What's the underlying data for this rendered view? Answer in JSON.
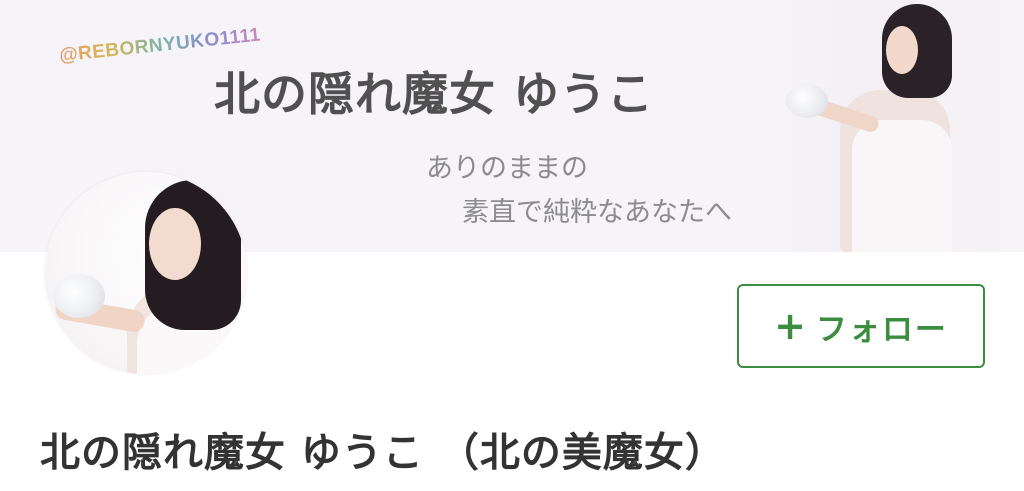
{
  "cover": {
    "handle": "@REBORNYUKO1111",
    "title": "北の隠れ魔女 ゆうこ",
    "tagline_line1": "ありのままの",
    "tagline_line2": "素直で純粋なあなたへ"
  },
  "follow_button": {
    "icon": "plus-icon",
    "plus_glyph": "+",
    "label": "フォロー",
    "accent_color": "#3b8d40"
  },
  "profile": {
    "name": "北の隠れ魔女 ゆうこ  （北の美魔女）",
    "avatar_icon": "avatar-photo"
  }
}
